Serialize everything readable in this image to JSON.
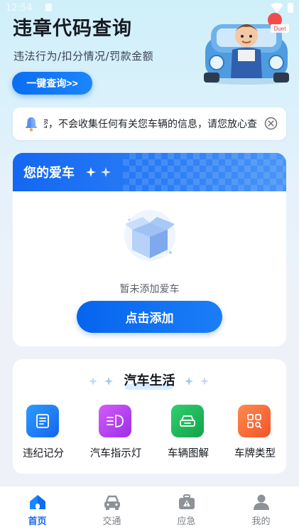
{
  "status_bar": {
    "time": "12:54"
  },
  "hero": {
    "title": "违章代码查询",
    "subtitle": "违法行为/扣分情况/罚款金额",
    "query_button": "一键查询>>",
    "mascot_tag": "Duet"
  },
  "notice": {
    "text": "私密，不会收集任何有关您车辆的信息，请您放心查"
  },
  "my_car": {
    "title": "您的爱车",
    "empty_text": "暂未添加爱车",
    "add_button": "点击添加"
  },
  "car_life": {
    "title": "汽车生活",
    "items": [
      {
        "label": "违纪记分",
        "icon": "score-list-icon",
        "color": "#1a84f5"
      },
      {
        "label": "汽车指示灯",
        "icon": "indicator-light-icon",
        "color": "#b23ef0"
      },
      {
        "label": "车辆图解",
        "icon": "car-diagram-icon",
        "color": "#1fb85a"
      },
      {
        "label": "车牌类型",
        "icon": "plate-type-icon",
        "color": "#fa6a32"
      }
    ]
  },
  "tabbar": {
    "tabs": [
      {
        "label": "首页",
        "icon": "home-icon",
        "active": true
      },
      {
        "label": "交通",
        "icon": "car-icon",
        "active": false
      },
      {
        "label": "应急",
        "icon": "emergency-kit-icon",
        "active": false
      },
      {
        "label": "我的",
        "icon": "profile-icon",
        "active": false
      }
    ]
  },
  "colors": {
    "accent": "#1566f0",
    "background_top": "#cfeff9"
  }
}
